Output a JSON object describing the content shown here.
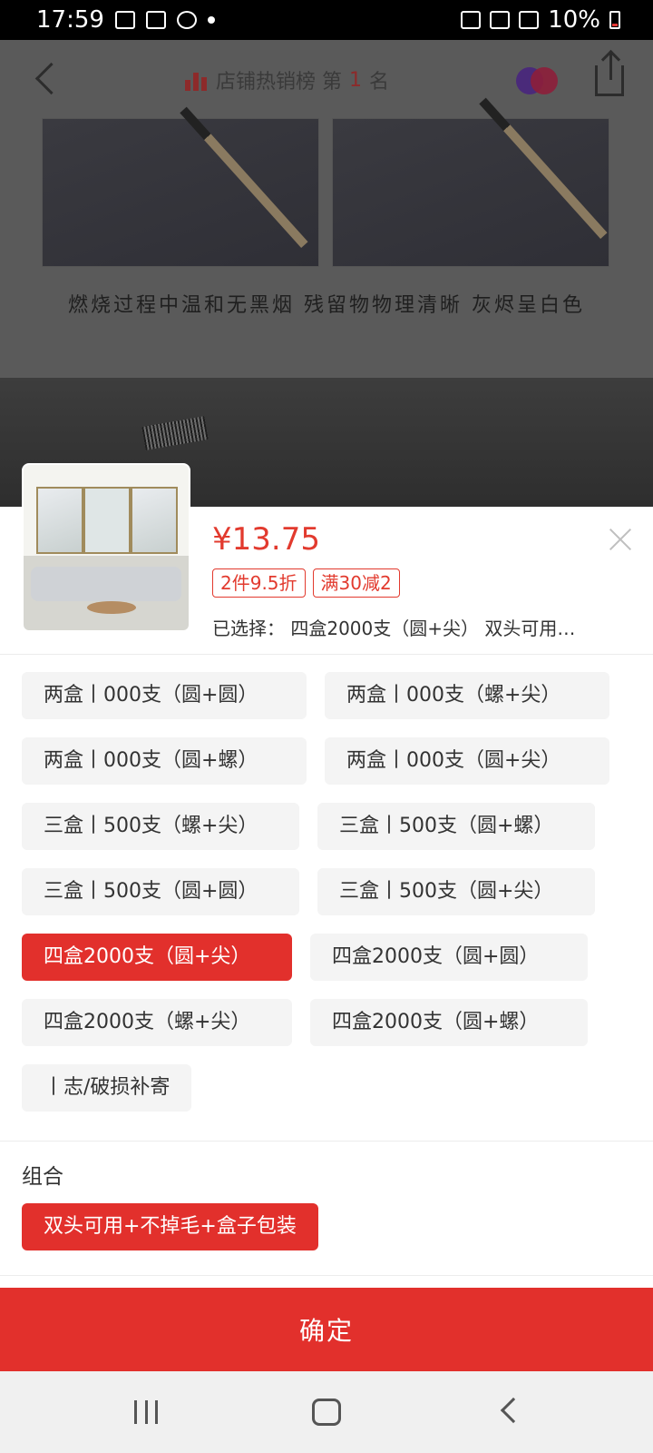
{
  "status_bar": {
    "time": "17:59",
    "battery_text": "10%",
    "icons": [
      "image-icon",
      "zalo-icon",
      "sync-icon",
      "notification-dot-icon",
      "battery-saver-icon",
      "wifi-icon",
      "signal-icon",
      "battery-icon"
    ]
  },
  "product_header": {
    "rank_label": "店铺热销榜 第",
    "rank_number": "1",
    "rank_suffix": "名",
    "caption": "燃烧过程中温和无黑烟 残留物物理清晰 灰烬呈白色"
  },
  "sku_panel": {
    "price": "¥13.75",
    "badges": [
      "2件9.5折",
      "满30减2"
    ],
    "selected_text": "已选择：  四盒2000支（圆+尖）  双头可用…",
    "options": [
      {
        "label": "两盒丨000支（圆+圆）",
        "selected": false
      },
      {
        "label": "两盒丨000支（螺+尖）",
        "selected": false
      },
      {
        "label": "两盒丨000支（圆+螺）",
        "selected": false
      },
      {
        "label": "两盒丨000支（圆+尖）",
        "selected": false
      },
      {
        "label": "三盒丨500支（螺+尖）",
        "selected": false
      },
      {
        "label": "三盒丨500支（圆+螺）",
        "selected": false
      },
      {
        "label": "三盒丨500支（圆+圆）",
        "selected": false
      },
      {
        "label": "三盒丨500支（圆+尖）",
        "selected": false
      },
      {
        "label": "四盒2000支（圆+尖）",
        "selected": true
      },
      {
        "label": "四盒2000支（圆+圆）",
        "selected": false
      },
      {
        "label": "四盒2000支（螺+尖）",
        "selected": false
      },
      {
        "label": "四盒2000支（圆+螺）",
        "selected": false
      },
      {
        "label": "丨志/破损补寄",
        "selected": false
      }
    ],
    "group_title": "组合",
    "group_option": "双头可用+不掉毛+盒子包装",
    "confirm_label": "确定"
  },
  "colors": {
    "accent": "#e2302c",
    "option_bg": "#f4f4f4",
    "overlay": "#4b4b4b"
  }
}
